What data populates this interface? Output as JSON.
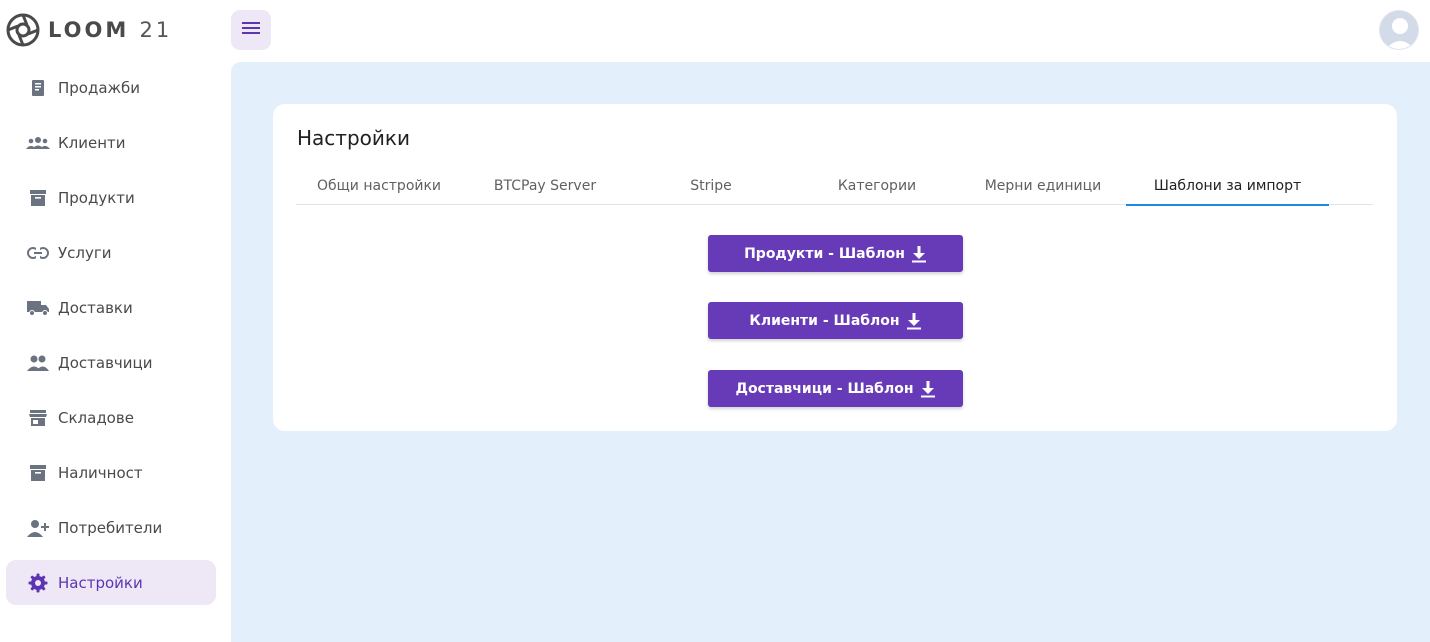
{
  "brand": {
    "name": "LOOM",
    "num": "21"
  },
  "sidebar": {
    "items": [
      {
        "label": "Продажби",
        "icon": "receipt-icon"
      },
      {
        "label": "Клиенти",
        "icon": "group-icon"
      },
      {
        "label": "Продукти",
        "icon": "archive-icon"
      },
      {
        "label": "Услуги",
        "icon": "link-icon"
      },
      {
        "label": "Доставки",
        "icon": "truck-icon"
      },
      {
        "label": "Доставчици",
        "icon": "people-icon"
      },
      {
        "label": "Складове",
        "icon": "store-icon"
      },
      {
        "label": "Наличност",
        "icon": "archive-icon"
      },
      {
        "label": "Потребители",
        "icon": "person-add-icon"
      },
      {
        "label": "Настройки",
        "icon": "gear-icon",
        "active": true
      }
    ]
  },
  "page": {
    "title": "Настройки",
    "tabs": [
      {
        "label": "Общи настройки"
      },
      {
        "label": "BTCPay Server"
      },
      {
        "label": "Stripe"
      },
      {
        "label": "Категории"
      },
      {
        "label": "Мерни единици"
      },
      {
        "label": "Шаблони за импорт",
        "active": true
      }
    ],
    "buttons": [
      {
        "label": "Продукти - Шаблон"
      },
      {
        "label": "Клиенти - Шаблон"
      },
      {
        "label": "Доставчици - Шаблон"
      }
    ]
  },
  "colors": {
    "accent": "#673ab7",
    "active_bg": "#ede7f6",
    "main_bg": "#e3f0fc",
    "tab_indicator": "#1e88e5"
  }
}
